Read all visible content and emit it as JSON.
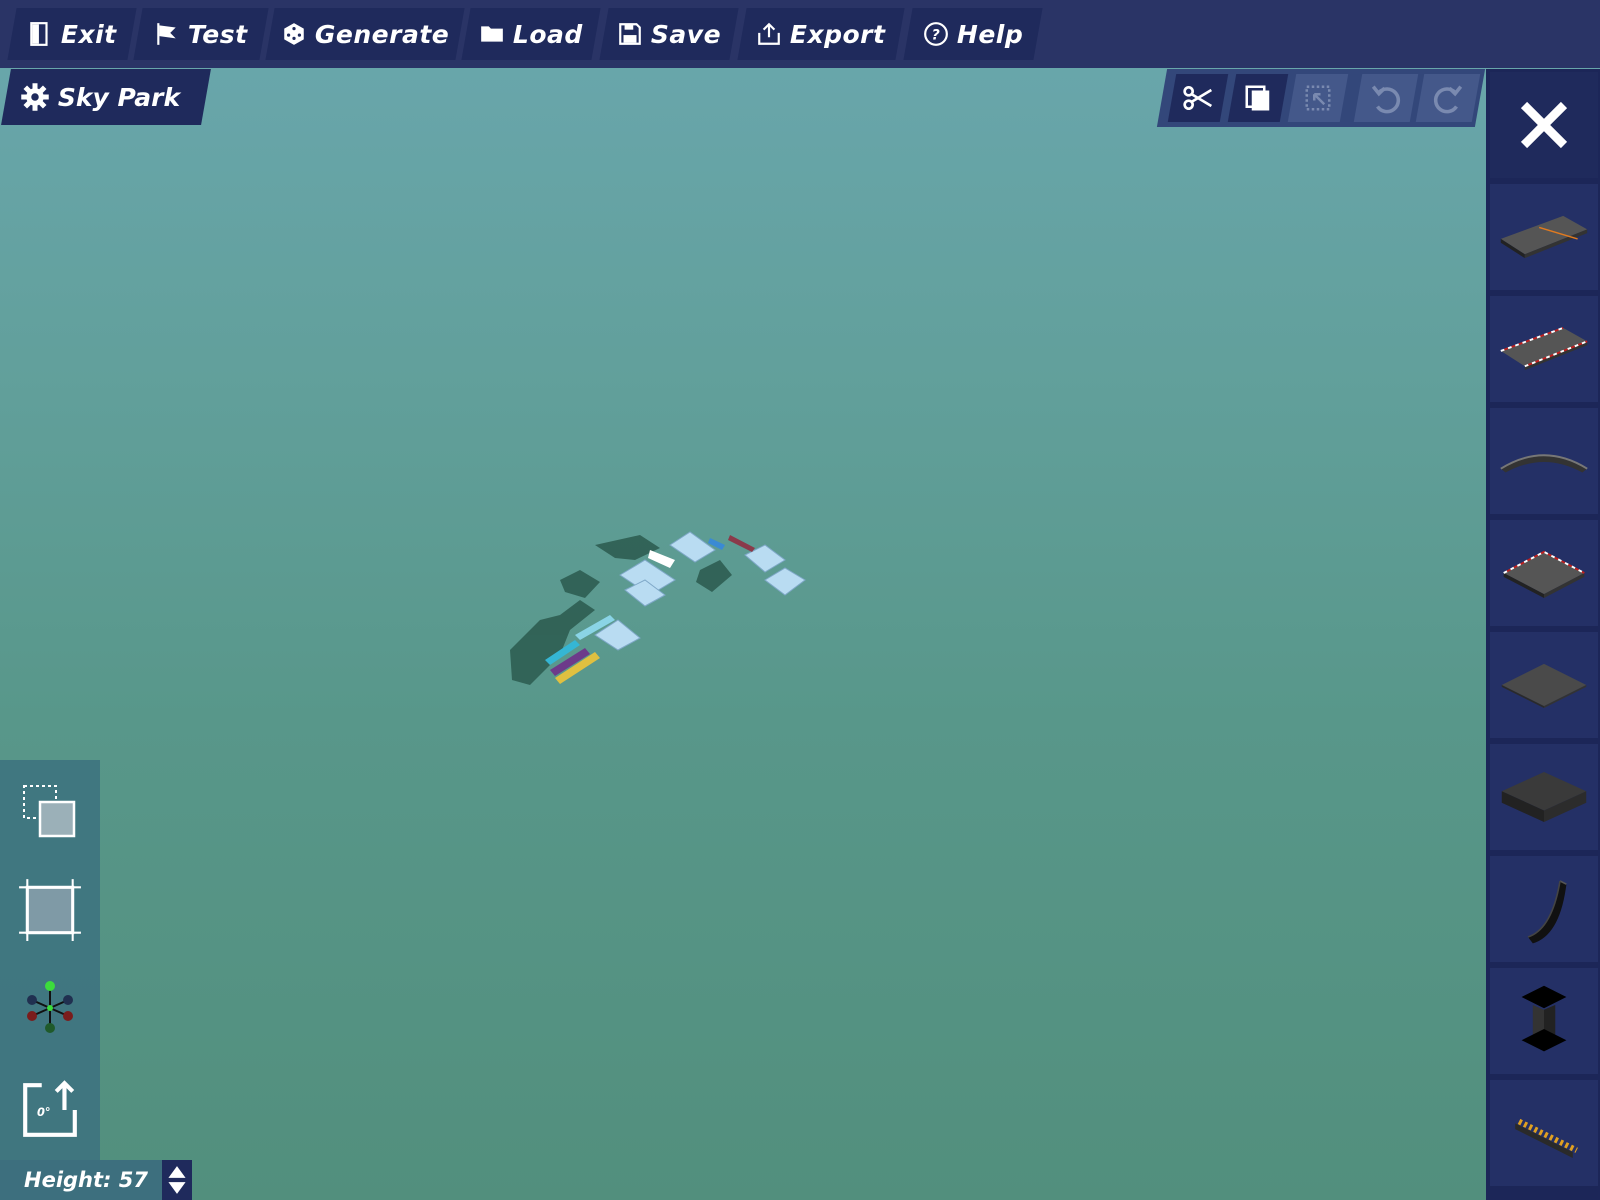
{
  "menu": {
    "exit": "Exit",
    "test": "Test",
    "generate": "Generate",
    "load": "Load",
    "save": "Save",
    "export": "Export",
    "help": "Help"
  },
  "project": {
    "title": "Sky Park"
  },
  "edit_toolbar": {
    "buttons": [
      {
        "icon": "scissors-icon",
        "enabled": true
      },
      {
        "icon": "copy-icon",
        "enabled": true
      },
      {
        "icon": "paste-icon",
        "enabled": false
      },
      {
        "icon": "undo-icon",
        "enabled": false
      },
      {
        "icon": "redo-icon",
        "enabled": false
      }
    ]
  },
  "palette": {
    "items": [
      "straight-track-piece-icon",
      "straight-track-striped-piece-icon",
      "curved-track-piece-icon",
      "square-track-piece-icon",
      "flat-tile-piece-icon",
      "block-piece-icon",
      "ramp-piece-icon",
      "pillar-piece-icon",
      "barrier-piece-icon"
    ]
  },
  "tools": [
    "select-area-icon",
    "crop-icon",
    "node-graph-icon",
    "rotate-icon"
  ],
  "rotate": {
    "label": "0°"
  },
  "height": {
    "label": "Height: 57"
  },
  "colors": {
    "menu_bg": "#2a3466",
    "button_bg": "#1f2a5c",
    "sky_top": "#6aa7ae",
    "sky_bottom": "#528f7d"
  }
}
